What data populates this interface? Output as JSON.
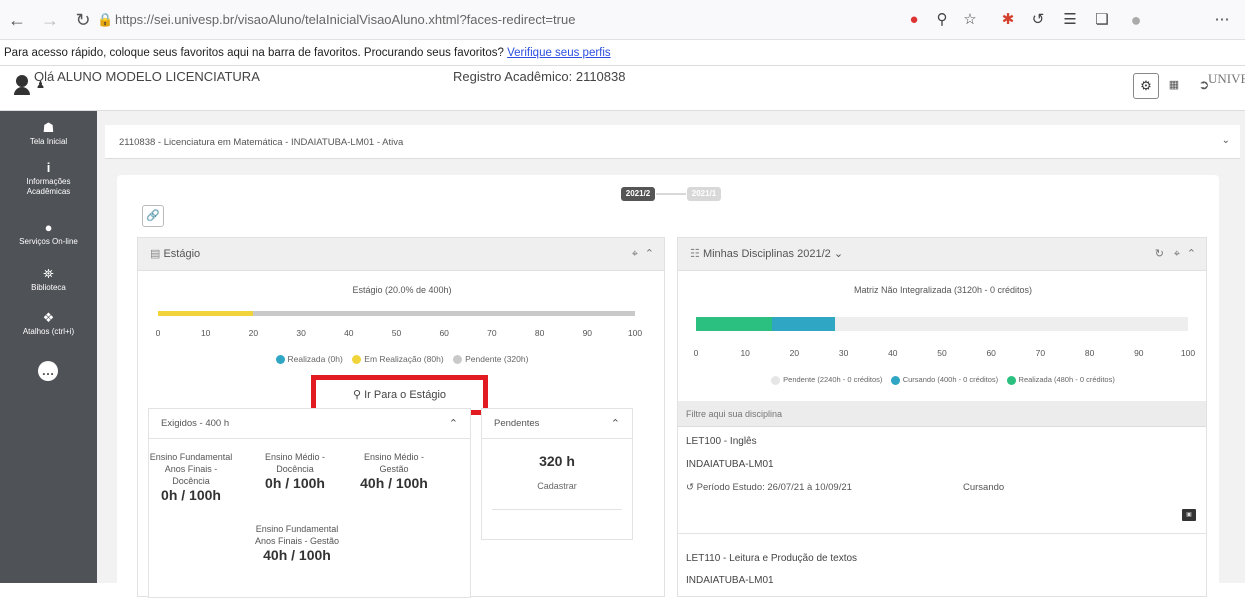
{
  "browser": {
    "url": "https://sei.univesp.br/visaoAluno/telaInicialVisaoAluno.xhtml?faces-redirect=true",
    "favbar_text": "Para acesso rápido, coloque seus favoritos aqui na barra de favoritos. Procurando seus favoritos?",
    "favbar_link": "Verifique seus perfis"
  },
  "header": {
    "greeting": "Olá ALUNO MODELO LICENCIATURA",
    "registro": "Registro Acadêmico: 2110838",
    "logo": "UNIVESP"
  },
  "sidebar": {
    "items": [
      {
        "icon": "home-icon",
        "label": "Tela Inicial"
      },
      {
        "icon": "info-icon",
        "label": "Informações Acadêmicas"
      },
      {
        "icon": "globe-icon",
        "label": "Serviços On-line"
      },
      {
        "icon": "library-icon",
        "label": "Biblioteca"
      },
      {
        "icon": "shortcut-icon",
        "label": "Atalhos (ctrl+i)"
      }
    ]
  },
  "course_select": {
    "value": "2110838 - Licenciatura em Matemática - INDAIATUBA-LM01 - Ativa"
  },
  "periods": {
    "active": "2021/2",
    "inactive": "2021/1"
  },
  "estagio": {
    "title": "Estágio",
    "progress_title": "Estágio (20.0% de 400h)",
    "progress": {
      "realizada": 0,
      "em_realizacao": 20,
      "pendente": 80
    },
    "ticks": [
      "0",
      "10",
      "20",
      "30",
      "40",
      "50",
      "60",
      "70",
      "80",
      "90",
      "100"
    ],
    "legend": {
      "realizada": "Realizada (0h)",
      "em_realizacao": "Em Realização (80h)",
      "pendente": "Pendente (320h)"
    },
    "go_button": "Ir Para o Estágio",
    "exigidos": {
      "title": "Exigidos - 400 h",
      "items": [
        {
          "label": "Ensino Fundamental Anos Finais - Docência",
          "value": "0h / 100h"
        },
        {
          "label": "Ensino Médio - Docência",
          "value": "0h / 100h"
        },
        {
          "label": "Ensino Médio - Gestão",
          "value": "40h / 100h"
        },
        {
          "label": "Ensino Fundamental Anos Finais - Gestão",
          "value": "40h / 100h"
        }
      ]
    },
    "pendentes": {
      "title": "Pendentes",
      "value": "320 h",
      "action": "Cadastrar"
    }
  },
  "disciplinas": {
    "title": "Minhas Disciplinas",
    "period": "2021/2",
    "matrix_title": "Matriz Não Integralizada (3120h - 0 créditos)",
    "progress": {
      "realizada": 15.4,
      "cursando": 12.8,
      "pendente": 71.8
    },
    "ticks": [
      "0",
      "10",
      "20",
      "30",
      "40",
      "50",
      "60",
      "70",
      "80",
      "90",
      "100"
    ],
    "legend": {
      "pendente": "Pendente (2240h - 0 créditos)",
      "cursando": "Cursando (400h - 0 créditos)",
      "realizada": "Realizada (480h - 0 créditos)"
    },
    "filter_placeholder": "Filtre aqui sua disciplina",
    "items": [
      {
        "code": "LET100 - Inglês",
        "class": "INDAIATUBA-LM01",
        "period": "Período Estudo: 26/07/21 à 10/09/21",
        "status": "Cursando"
      },
      {
        "code": "LET110 - Leitura e Produção de textos",
        "class": "INDAIATUBA-LM01"
      }
    ]
  },
  "colors": {
    "yellow": "#f0d43a",
    "gray": "#c9c9c9",
    "teal": "#2fa6c4",
    "green": "#2bc07f",
    "highlight": "#e21b23"
  }
}
